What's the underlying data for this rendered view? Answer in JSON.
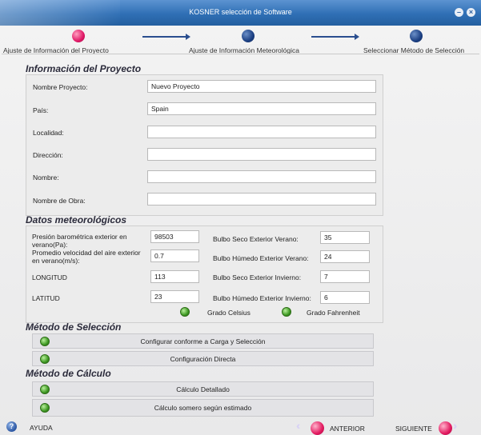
{
  "window": {
    "title": "KOSNER selección de Software",
    "minimize_glyph": "–",
    "close_glyph": "×"
  },
  "steps": [
    {
      "label": "Ajuste de Información del Proyecto",
      "state": "active",
      "color": "#e01866"
    },
    {
      "label": "Ajuste de Información Meteorológica",
      "state": "pending",
      "color": "#1b3f82"
    },
    {
      "label": "Seleccionar Método de Selección",
      "state": "pending",
      "color": "#1b3f82"
    }
  ],
  "project": {
    "title": "Información del Proyecto",
    "fields": [
      {
        "label": "Nombre Proyecto:",
        "value": "Nuevo Proyecto"
      },
      {
        "label": "País:",
        "value": "Spain"
      },
      {
        "label": "Localidad:",
        "value": ""
      },
      {
        "label": "Dirección:",
        "value": ""
      },
      {
        "label": "Nombre:",
        "value": ""
      },
      {
        "label": "Nombre de Obra:",
        "value": ""
      }
    ]
  },
  "weather": {
    "title": "Datos meteorológicos",
    "left": [
      {
        "label": "Presión barométrica exterior en verano(Pa):",
        "value": "98503"
      },
      {
        "label": "Promedio velocidad del aire exterior en verano(m/s):",
        "value": "0.7"
      },
      {
        "label": "LONGITUD",
        "value": "113"
      },
      {
        "label": "LATITUD",
        "value": "23"
      }
    ],
    "right": [
      {
        "label": "Bulbo Seco Exterior Verano:",
        "value": "35"
      },
      {
        "label": "Bulbo Húmedo Exterior Verano:",
        "value": "24"
      },
      {
        "label": "Bulbo Seco Exterior Invierno:",
        "value": "7"
      },
      {
        "label": "Bulbo Húmedo Exterior Invierno:",
        "value": "6"
      }
    ],
    "units": [
      {
        "label": "Grado Celsius",
        "selected": true
      },
      {
        "label": "Grado Fahrenheit",
        "selected": false
      }
    ]
  },
  "selection_method": {
    "title": "Método de Selección",
    "options": [
      {
        "label": "Configurar conforme a Carga y Selección"
      },
      {
        "label": "Configuración Directa"
      }
    ]
  },
  "calc_method": {
    "title": "Método de Cálculo",
    "options": [
      {
        "label": "Cálculo Detallado"
      },
      {
        "label": "Cálculo somero según estimado"
      }
    ]
  },
  "footer": {
    "help_label": "AYUDA",
    "help_glyph": "?",
    "prev_label": "ANTERIOR",
    "next_label": "SIGUIENTE",
    "prev_chevrons": "‹‹",
    "next_chevrons": "››"
  },
  "colors": {
    "accent_pink": "#e01866",
    "accent_navy": "#1b3f82",
    "radio_green": "#3f9a23",
    "titlebar_blue": "#2f6fb5"
  }
}
